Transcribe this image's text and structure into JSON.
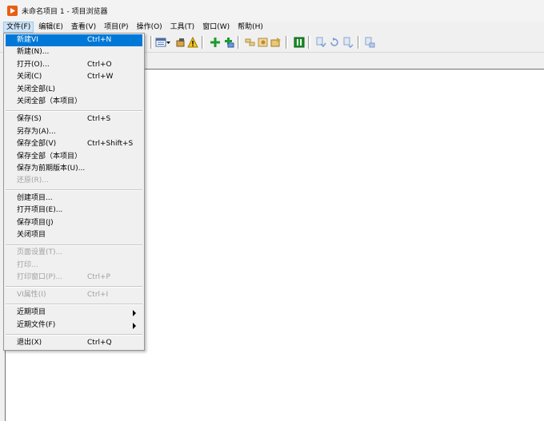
{
  "window": {
    "title": "未命名项目 1 - 项目浏览器",
    "icon": "labview-project-icon",
    "accent_color": "#e65f14"
  },
  "menubar": {
    "items": [
      {
        "label": "文件(F)",
        "active": true
      },
      {
        "label": "编辑(E)"
      },
      {
        "label": "查看(V)"
      },
      {
        "label": "项目(P)"
      },
      {
        "label": "操作(O)"
      },
      {
        "label": "工具(T)"
      },
      {
        "label": "窗口(W)"
      },
      {
        "label": "帮助(H)"
      }
    ]
  },
  "toolbar": {
    "icons": [
      "view-list-icon",
      "dropdown-icon",
      "build-icon",
      "warning-icon",
      "add-icon",
      "add-folder-icon",
      "dependencies-icon",
      "settings-icon",
      "configure-icon",
      "run-icon",
      "expand-icon",
      "refresh-icon",
      "collapse-icon",
      "help-icon"
    ]
  },
  "file_menu": {
    "items": [
      {
        "label": "新建VI",
        "shortcut": "Ctrl+N",
        "highlight": true
      },
      {
        "label": "新建(N)...",
        "shortcut": ""
      },
      {
        "label": "打开(O)...",
        "shortcut": "Ctrl+O"
      },
      {
        "label": "关闭(C)",
        "shortcut": "Ctrl+W"
      },
      {
        "label": "关闭全部(L)",
        "shortcut": ""
      },
      {
        "label": "关闭全部（本项目）",
        "shortcut": ""
      },
      {
        "separator": true
      },
      {
        "label": "保存(S)",
        "shortcut": "Ctrl+S"
      },
      {
        "label": "另存为(A)...",
        "shortcut": ""
      },
      {
        "label": "保存全部(V)",
        "shortcut": "Ctrl+Shift+S"
      },
      {
        "label": "保存全部（本项目）",
        "shortcut": ""
      },
      {
        "label": "保存为前期版本(U)...",
        "shortcut": ""
      },
      {
        "label": "还原(R)...",
        "shortcut": "",
        "disabled": true
      },
      {
        "separator": true
      },
      {
        "label": "创建项目...",
        "shortcut": ""
      },
      {
        "label": "打开项目(E)...",
        "shortcut": ""
      },
      {
        "label": "保存项目(J)",
        "shortcut": ""
      },
      {
        "label": "关闭项目",
        "shortcut": ""
      },
      {
        "separator": true
      },
      {
        "label": "页面设置(T)...",
        "shortcut": "",
        "disabled": true
      },
      {
        "label": "打印...",
        "shortcut": "",
        "disabled": true
      },
      {
        "label": "打印窗口(P)...",
        "shortcut": "Ctrl+P",
        "disabled": true
      },
      {
        "separator": true
      },
      {
        "label": "VI属性(I)",
        "shortcut": "Ctrl+I",
        "disabled": true
      },
      {
        "separator": true
      },
      {
        "label": "近期项目",
        "shortcut": "",
        "submenu": true
      },
      {
        "label": "近期文件(F)",
        "shortcut": "",
        "submenu": true
      },
      {
        "separator": true
      },
      {
        "label": "退出(X)",
        "shortcut": "Ctrl+Q"
      }
    ]
  }
}
